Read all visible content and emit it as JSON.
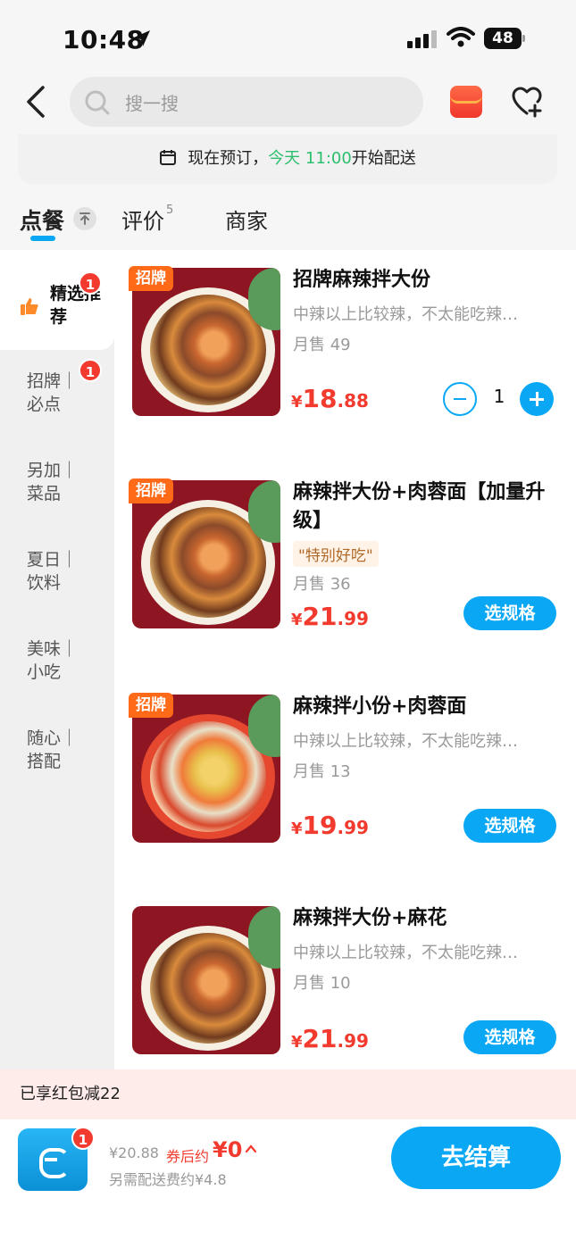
{
  "status_bar": {
    "time": "10:48",
    "battery": "48"
  },
  "search": {
    "placeholder": "搜一搜"
  },
  "preorder": {
    "prefix": "现在预订，",
    "highlight": "今天 11:00",
    "suffix": "开始配送"
  },
  "tabs": [
    {
      "label": "点餐"
    },
    {
      "label": "评价",
      "count": "5"
    },
    {
      "label": "商家"
    }
  ],
  "categories": [
    {
      "label": "精选推荐",
      "badge": "1"
    },
    {
      "label": "招牌｜必点",
      "badge": "1"
    },
    {
      "label": "另加｜菜品"
    },
    {
      "label": "夏日｜饮料"
    },
    {
      "label": "美味｜小吃"
    },
    {
      "label": "随心｜搭配"
    }
  ],
  "items": [
    {
      "tag": "招牌",
      "name": "招牌麻辣拌大份",
      "desc": "中辣以上比较辣，不太能吃辣…",
      "sales": "月售 49",
      "currency": "¥",
      "price_int": "18",
      "price_dec": ".88",
      "quantity": "1"
    },
    {
      "tag": "招牌",
      "name": "麻辣拌大份+肉蓉面【加量升级】",
      "tagline": "\"特别好吃\"",
      "sales": "月售 36",
      "currency": "¥",
      "price_int": "21",
      "price_dec": ".99",
      "action": "选规格"
    },
    {
      "tag": "招牌",
      "name": "麻辣拌小份+肉蓉面",
      "desc": "中辣以上比较辣，不太能吃辣…",
      "sales": "月售 13",
      "currency": "¥",
      "price_int": "19",
      "price_dec": ".99",
      "action": "选规格"
    },
    {
      "name": "麻辣拌大份+麻花",
      "desc": "中辣以上比较辣，不太能吃辣…",
      "sales": "月售 10",
      "currency": "¥",
      "price_int": "21",
      "price_dec": ".99",
      "action": "选规格"
    }
  ],
  "discount": {
    "text": "已享红包减22"
  },
  "checkout": {
    "cart_badge": "1",
    "original_price": "¥20.88",
    "after_label": "券后约",
    "after_price": "¥0",
    "delivery_fee": "另需配送费约¥4.8",
    "button": "去结算"
  },
  "colors": {
    "accent": "#0aa8f4",
    "price": "#f23b2e",
    "tag": "#ff6a18",
    "highlight": "#2bbf6d"
  }
}
